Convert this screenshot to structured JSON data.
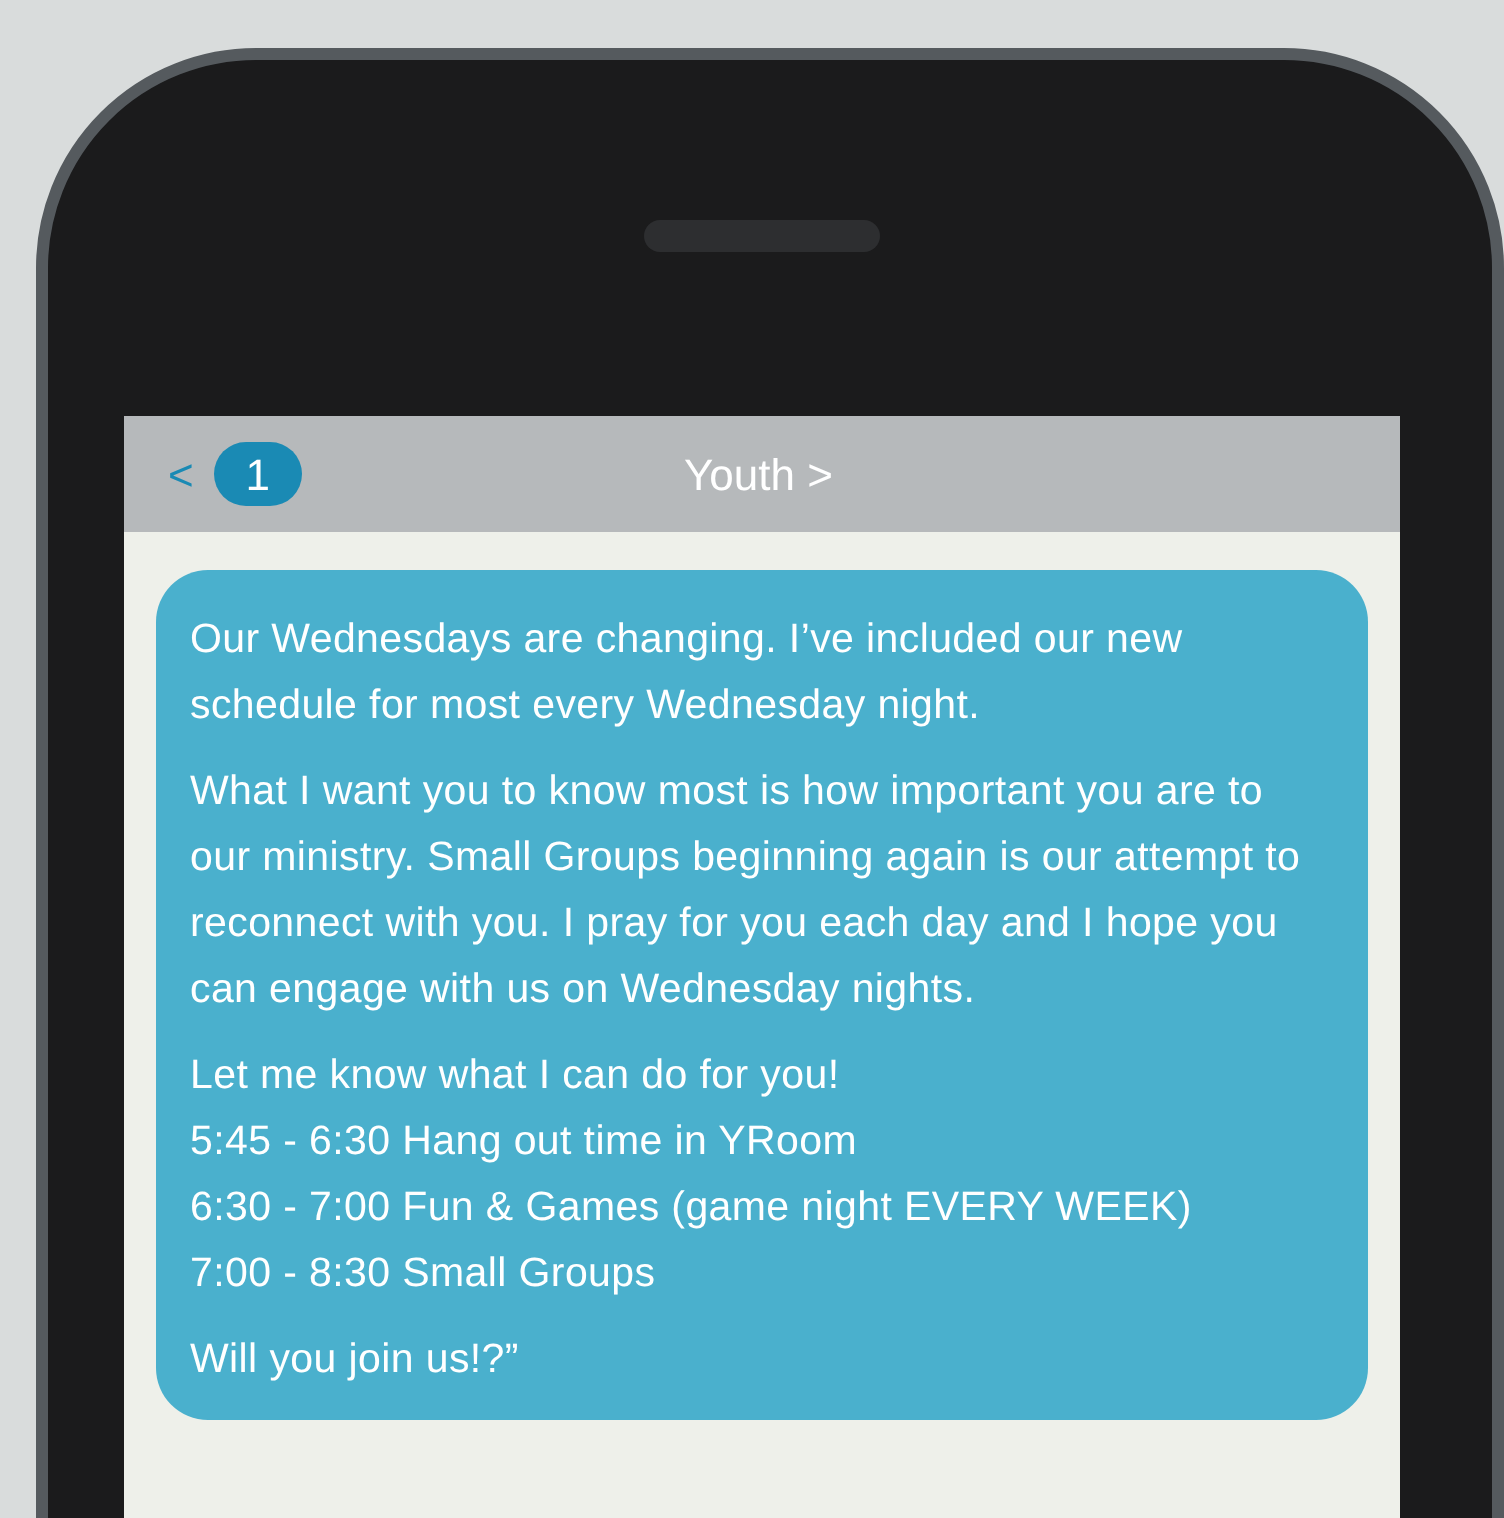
{
  "header": {
    "back": "<",
    "badge": "1",
    "title": "Youth >"
  },
  "message": {
    "paragraphs": [
      [
        "Our Wednesdays are changing. I’ve included our new schedule for most every Wednesday night."
      ],
      [
        "What I want you to know most is how important you are to our ministry. Small Groups beginning again is our attempt to reconnect with you. I pray for you each day and I hope you can engage with us on Wednesday nights."
      ],
      [
        "Let me know what I can do for you!",
        "5:45 - 6:30 Hang out time in YRoom",
        "6:30 - 7:00 Fun & Games (game night EVERY WEEK)",
        "7:00 - 8:30 Small Groups"
      ],
      [
        "Will you join us!?”"
      ]
    ]
  }
}
